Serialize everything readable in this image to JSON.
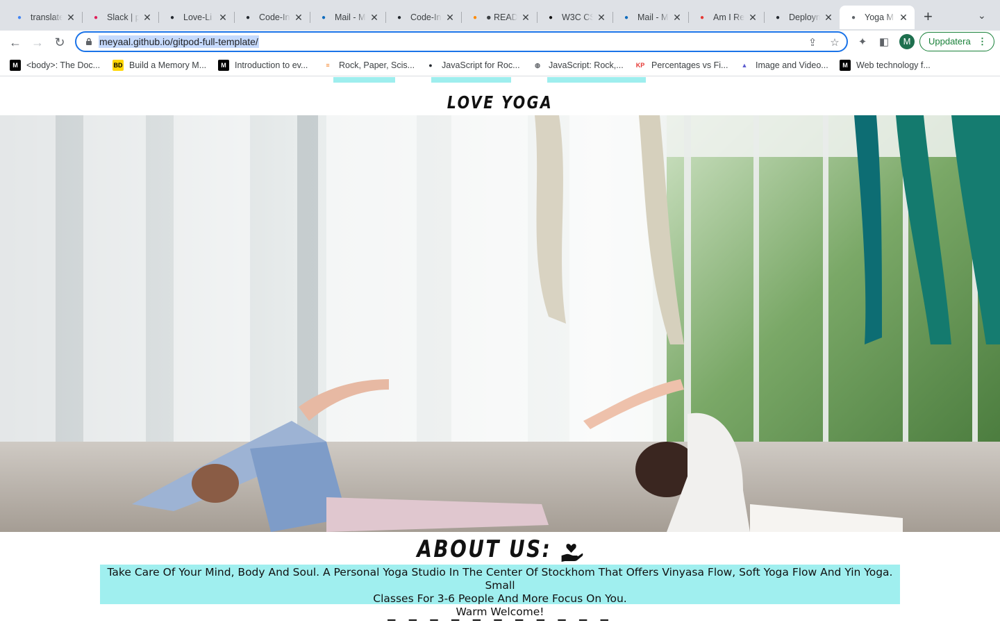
{
  "browser": {
    "tabs": [
      {
        "title": "translate",
        "icon": "google-icon",
        "color": "#4285f4"
      },
      {
        "title": "Slack | p",
        "icon": "slack-icon",
        "color": "#e01e5a"
      },
      {
        "title": "Love-Li",
        "icon": "github-icon",
        "color": "#24292f"
      },
      {
        "title": "Code-In",
        "icon": "github-icon",
        "color": "#24292f"
      },
      {
        "title": "Mail - M",
        "icon": "outlook-icon",
        "color": "#0f6cbd"
      },
      {
        "title": "Code-In",
        "icon": "github-icon",
        "color": "#24292f"
      },
      {
        "title": "● READ",
        "icon": "gitpod-icon",
        "color": "#ff8a00"
      },
      {
        "title": "W3C CS",
        "icon": "w3c-icon",
        "color": "#111111"
      },
      {
        "title": "Mail - M",
        "icon": "outlook-icon",
        "color": "#0f6cbd"
      },
      {
        "title": "Am I Re",
        "icon": "amiresponsive-icon",
        "color": "#e53935"
      },
      {
        "title": "Deploym",
        "icon": "github-icon",
        "color": "#24292f"
      },
      {
        "title": "Yoga M",
        "icon": "globe-icon",
        "color": "#5f6368",
        "active": true
      }
    ],
    "url_text": "meyaal.github.io/gitpod-full-template/",
    "update_label": "Uppdatera",
    "profile_initial": "M",
    "bookmarks": [
      {
        "label": "<body>: The Doc...",
        "icon": "mdn-icon",
        "badge": "M",
        "color": "#000000"
      },
      {
        "label": "Build a Memory M...",
        "icon": "bd-icon",
        "badge": "BD",
        "color": "#ffd600"
      },
      {
        "label": "Introduction to ev...",
        "icon": "mdn-icon",
        "badge": "M",
        "color": "#000000"
      },
      {
        "label": "Rock, Paper, Scis...",
        "icon": "stackoverflow-icon",
        "badge": "≡",
        "color": "#f48024"
      },
      {
        "label": "JavaScript for Roc...",
        "icon": "github-icon",
        "badge": "●",
        "color": "#24292f"
      },
      {
        "label": "JavaScript: Rock,...",
        "icon": "globe-icon",
        "badge": "◍",
        "color": "#5f6368"
      },
      {
        "label": "Percentages vs Fi...",
        "icon": "kp-icon",
        "badge": "KP",
        "color": "#e53935"
      },
      {
        "label": "Image and Video...",
        "icon": "image-icon",
        "badge": "▲",
        "color": "#5c5ccf"
      },
      {
        "label": "Web technology f...",
        "icon": "mdn-icon",
        "badge": "M",
        "color": "#000000"
      }
    ]
  },
  "page": {
    "site_title": "LOVE YOGA",
    "about_heading": "ABOUT US:",
    "about_text_line1": "Take Care Of Your Mind, Body And Soul. A Personal Yoga Studio In The Center Of Stockhom That Offers Vinyasa Flow, Soft Yoga Flow And Yin Yoga. Small",
    "about_text_line2": "Classes For 3-6 People And More Focus On You.",
    "about_text_line3": "Warm Welcome!",
    "accent_color": "#a0efef"
  }
}
